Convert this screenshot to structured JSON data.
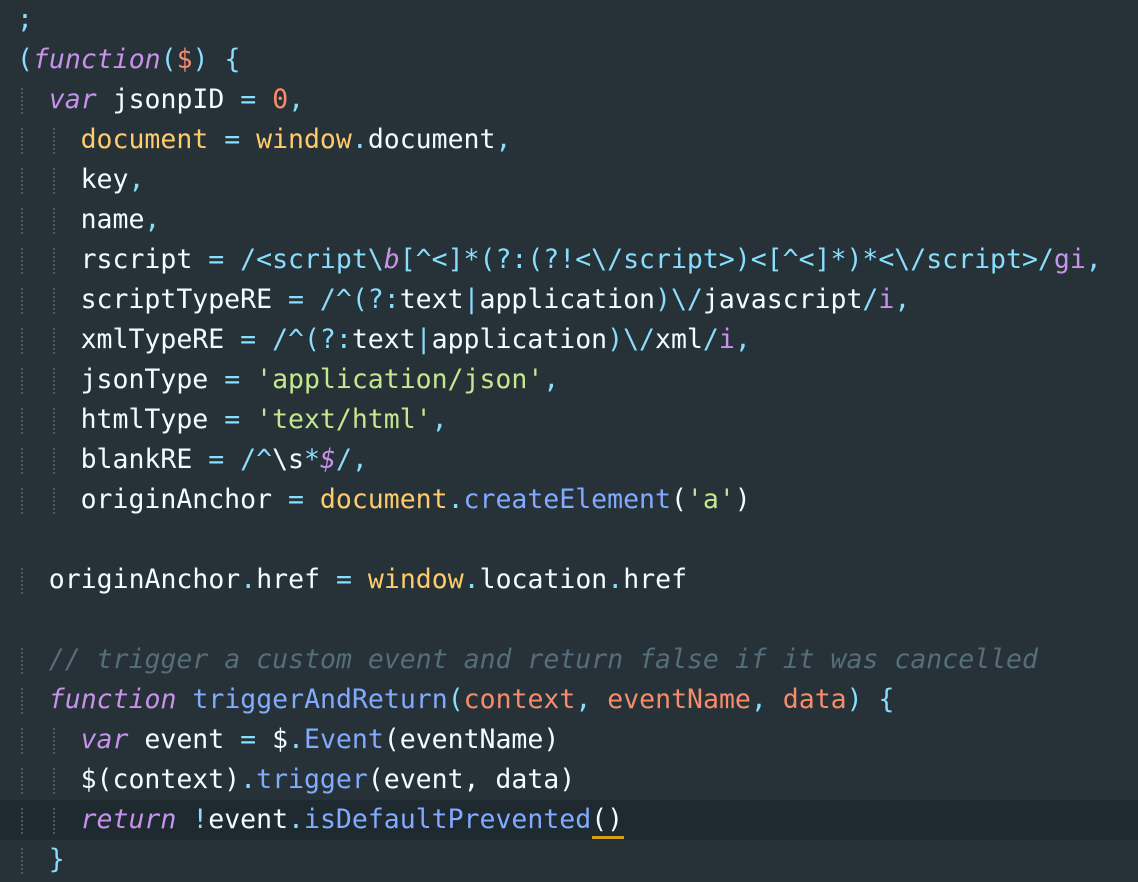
{
  "theme": {
    "background": "#263238",
    "current_line": "#1e2a2f",
    "default": "#eeffff",
    "keyword": "#c792ea",
    "function": "#82aaff",
    "number": "#f78c6c",
    "string": "#c3e88d",
    "regex": "#89ddff",
    "operator": "#89ddff",
    "global": "#ffcb6b",
    "param": "#f78c6c",
    "comment": "#546e7a",
    "punct": "#89ddff"
  },
  "lines": [
    {
      "indent": 0,
      "tokens": [
        {
          "t": ";",
          "c": "punct"
        }
      ]
    },
    {
      "indent": 0,
      "tokens": [
        {
          "t": "(",
          "c": "punct"
        },
        {
          "t": "function",
          "c": "keyword",
          "i": true
        },
        {
          "t": "(",
          "c": "punct"
        },
        {
          "t": "$",
          "c": "param"
        },
        {
          "t": ") {",
          "c": "punct"
        }
      ]
    },
    {
      "indent": 1,
      "tokens": [
        {
          "t": "var",
          "c": "keyword",
          "i": true
        },
        {
          "t": " jsonpID ",
          "c": "default"
        },
        {
          "t": "=",
          "c": "operator"
        },
        {
          "t": " ",
          "c": "default"
        },
        {
          "t": "0",
          "c": "number"
        },
        {
          "t": ",",
          "c": "punct"
        }
      ]
    },
    {
      "indent": 2,
      "tokens": [
        {
          "t": "document",
          "c": "global"
        },
        {
          "t": " = ",
          "c": "operator"
        },
        {
          "t": "window",
          "c": "global"
        },
        {
          "t": ".",
          "c": "punct"
        },
        {
          "t": "document",
          "c": "default"
        },
        {
          "t": ",",
          "c": "punct"
        }
      ]
    },
    {
      "indent": 2,
      "tokens": [
        {
          "t": "key",
          "c": "default"
        },
        {
          "t": ",",
          "c": "punct"
        }
      ]
    },
    {
      "indent": 2,
      "tokens": [
        {
          "t": "name",
          "c": "default"
        },
        {
          "t": ",",
          "c": "punct"
        }
      ]
    },
    {
      "indent": 2,
      "tokens": [
        {
          "t": "rscript",
          "c": "default"
        },
        {
          "t": " = ",
          "c": "operator"
        },
        {
          "t": "/<script\\",
          "c": "regex"
        },
        {
          "t": "b",
          "c": "keyword",
          "i": true
        },
        {
          "t": "[^<]*(?:(?!<\\/script>)<[^<]*)*<\\/script>/",
          "c": "regex"
        },
        {
          "t": "gi",
          "c": "keyword"
        },
        {
          "t": ",",
          "c": "punct"
        }
      ]
    },
    {
      "indent": 2,
      "tokens": [
        {
          "t": "scriptTypeRE",
          "c": "default"
        },
        {
          "t": " = ",
          "c": "operator"
        },
        {
          "t": "/^(?:",
          "c": "regex"
        },
        {
          "t": "text",
          "c": "default"
        },
        {
          "t": "|",
          "c": "regex"
        },
        {
          "t": "application",
          "c": "default"
        },
        {
          "t": ")\\/",
          "c": "regex"
        },
        {
          "t": "javascript",
          "c": "default"
        },
        {
          "t": "/",
          "c": "regex"
        },
        {
          "t": "i",
          "c": "keyword"
        },
        {
          "t": ",",
          "c": "punct"
        }
      ]
    },
    {
      "indent": 2,
      "tokens": [
        {
          "t": "xmlTypeRE",
          "c": "default"
        },
        {
          "t": " = ",
          "c": "operator"
        },
        {
          "t": "/^(?:",
          "c": "regex"
        },
        {
          "t": "text",
          "c": "default"
        },
        {
          "t": "|",
          "c": "regex"
        },
        {
          "t": "application",
          "c": "default"
        },
        {
          "t": ")\\/",
          "c": "regex"
        },
        {
          "t": "xml",
          "c": "default"
        },
        {
          "t": "/",
          "c": "regex"
        },
        {
          "t": "i",
          "c": "keyword"
        },
        {
          "t": ",",
          "c": "punct"
        }
      ]
    },
    {
      "indent": 2,
      "tokens": [
        {
          "t": "jsonType",
          "c": "default"
        },
        {
          "t": " = ",
          "c": "operator"
        },
        {
          "t": "'application/json'",
          "c": "string"
        },
        {
          "t": ",",
          "c": "punct"
        }
      ]
    },
    {
      "indent": 2,
      "tokens": [
        {
          "t": "htmlType",
          "c": "default"
        },
        {
          "t": " = ",
          "c": "operator"
        },
        {
          "t": "'text/html'",
          "c": "string"
        },
        {
          "t": ",",
          "c": "punct"
        }
      ]
    },
    {
      "indent": 2,
      "tokens": [
        {
          "t": "blankRE",
          "c": "default"
        },
        {
          "t": " = ",
          "c": "operator"
        },
        {
          "t": "/^",
          "c": "regex"
        },
        {
          "t": "\\s",
          "c": "default"
        },
        {
          "t": "*",
          "c": "regex"
        },
        {
          "t": "$",
          "c": "keyword",
          "i": true
        },
        {
          "t": "/",
          "c": "regex"
        },
        {
          "t": ",",
          "c": "punct"
        }
      ]
    },
    {
      "indent": 2,
      "tokens": [
        {
          "t": "originAnchor",
          "c": "default"
        },
        {
          "t": " = ",
          "c": "operator"
        },
        {
          "t": "document",
          "c": "global"
        },
        {
          "t": ".",
          "c": "punct"
        },
        {
          "t": "createElement",
          "c": "function"
        },
        {
          "t": "(",
          "c": "default"
        },
        {
          "t": "'a'",
          "c": "string"
        },
        {
          "t": ")",
          "c": "default"
        }
      ]
    },
    {
      "indent": 0,
      "tokens": []
    },
    {
      "indent": 1,
      "tokens": [
        {
          "t": "originAnchor",
          "c": "default"
        },
        {
          "t": ".",
          "c": "punct"
        },
        {
          "t": "href",
          "c": "default"
        },
        {
          "t": " = ",
          "c": "operator"
        },
        {
          "t": "window",
          "c": "global"
        },
        {
          "t": ".",
          "c": "punct"
        },
        {
          "t": "location",
          "c": "default"
        },
        {
          "t": ".",
          "c": "punct"
        },
        {
          "t": "href",
          "c": "default"
        }
      ]
    },
    {
      "indent": 0,
      "tokens": []
    },
    {
      "indent": 1,
      "tokens": [
        {
          "t": "// trigger a custom event and return false if it was cancelled",
          "c": "comment",
          "i": true
        }
      ]
    },
    {
      "indent": 1,
      "tokens": [
        {
          "t": "function",
          "c": "keyword",
          "i": true
        },
        {
          "t": " ",
          "c": "default"
        },
        {
          "t": "triggerAndReturn",
          "c": "function"
        },
        {
          "t": "(",
          "c": "punct"
        },
        {
          "t": "context",
          "c": "param"
        },
        {
          "t": ", ",
          "c": "punct"
        },
        {
          "t": "eventName",
          "c": "param"
        },
        {
          "t": ", ",
          "c": "punct"
        },
        {
          "t": "data",
          "c": "param"
        },
        {
          "t": ") {",
          "c": "punct"
        }
      ]
    },
    {
      "indent": 2,
      "tokens": [
        {
          "t": "var",
          "c": "keyword",
          "i": true
        },
        {
          "t": " event ",
          "c": "default"
        },
        {
          "t": "=",
          "c": "operator"
        },
        {
          "t": " $",
          "c": "default"
        },
        {
          "t": ".",
          "c": "punct"
        },
        {
          "t": "Event",
          "c": "function"
        },
        {
          "t": "(eventName)",
          "c": "default"
        }
      ]
    },
    {
      "indent": 2,
      "tokens": [
        {
          "t": "$(context)",
          "c": "default"
        },
        {
          "t": ".",
          "c": "punct"
        },
        {
          "t": "trigger",
          "c": "function"
        },
        {
          "t": "(event, data)",
          "c": "default"
        }
      ]
    },
    {
      "indent": 2,
      "current": true,
      "tokens": [
        {
          "t": "return",
          "c": "keyword",
          "i": true
        },
        {
          "t": " !",
          "c": "operator"
        },
        {
          "t": "event",
          "c": "default"
        },
        {
          "t": ".",
          "c": "punct"
        },
        {
          "t": "isDefaultPrevented",
          "c": "function"
        },
        {
          "t": "()",
          "c": "default"
        }
      ]
    },
    {
      "indent": 1,
      "tokens": [
        {
          "t": "}",
          "c": "punct"
        }
      ]
    }
  ]
}
